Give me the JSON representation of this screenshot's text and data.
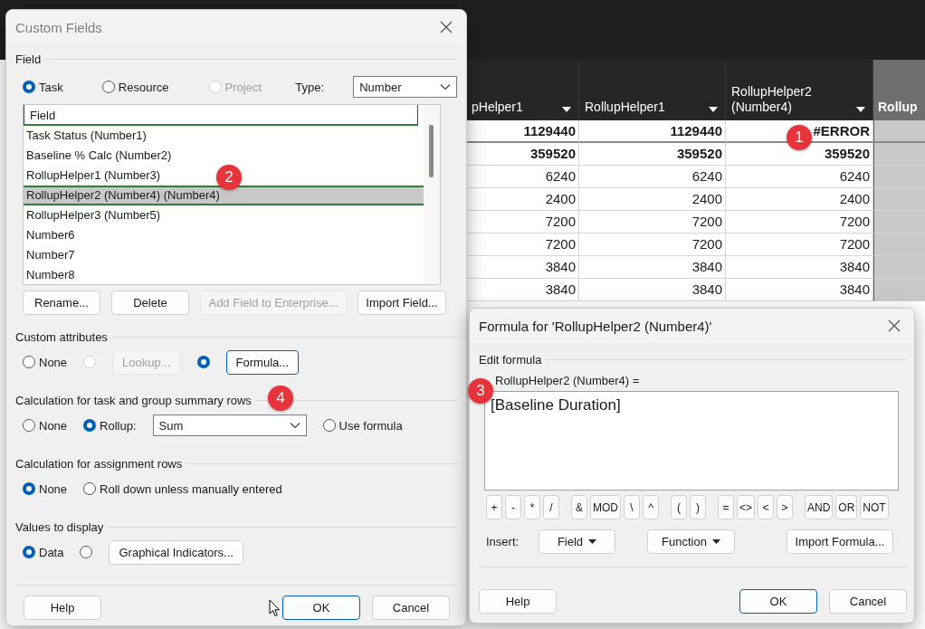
{
  "project_grid": {
    "columns": [
      {
        "header": "pHelper1",
        "selected": false
      },
      {
        "header": "RollupHelper1",
        "selected": false
      },
      {
        "header": "RollupHelper2 (Number4)",
        "selected": false
      },
      {
        "header": "Rollup",
        "selected": true
      }
    ],
    "rows": [
      {
        "bold": true,
        "cells": [
          "1129440",
          "1129440",
          "#ERROR",
          ""
        ]
      },
      {
        "bold": true,
        "cells": [
          "359520",
          "359520",
          "359520",
          ""
        ]
      },
      {
        "bold": false,
        "cells": [
          "6240",
          "6240",
          "6240",
          ""
        ]
      },
      {
        "bold": false,
        "cells": [
          "2400",
          "2400",
          "2400",
          ""
        ]
      },
      {
        "bold": false,
        "cells": [
          "7200",
          "7200",
          "7200",
          ""
        ]
      },
      {
        "bold": false,
        "cells": [
          "7200",
          "7200",
          "7200",
          ""
        ]
      },
      {
        "bold": false,
        "cells": [
          "3840",
          "3840",
          "3840",
          ""
        ]
      },
      {
        "bold": false,
        "cells": [
          "3840",
          "3840",
          "3840",
          ""
        ]
      }
    ]
  },
  "custom_fields_dialog": {
    "title": "Custom Fields",
    "field_section": {
      "label": "Field",
      "entity_options": [
        {
          "label": "Task",
          "selected": true,
          "disabled": false
        },
        {
          "label": "Resource",
          "selected": false,
          "disabled": false
        },
        {
          "label": "Project",
          "selected": false,
          "disabled": true
        }
      ],
      "type_label": "Type:",
      "type_value": "Number"
    },
    "field_list": {
      "header": "Field",
      "items": [
        {
          "label": "Task Status (Number1)",
          "selected": false
        },
        {
          "label": "Baseline % Calc (Number2)",
          "selected": false
        },
        {
          "label": "RollupHelper1 (Number3)",
          "selected": false
        },
        {
          "label": "RollupHelper2 (Number4) (Number4)",
          "selected": true
        },
        {
          "label": "RollupHelper3 (Number5)",
          "selected": false
        },
        {
          "label": "Number6",
          "selected": false
        },
        {
          "label": "Number7",
          "selected": false
        },
        {
          "label": "Number8",
          "selected": false
        }
      ]
    },
    "field_buttons": [
      {
        "label": "Rename...",
        "disabled": false
      },
      {
        "label": "Delete",
        "disabled": false
      },
      {
        "label": "Add Field to Enterprise...",
        "disabled": true
      },
      {
        "label": "Import Field...",
        "disabled": false
      }
    ],
    "sections": [
      {
        "label": "Custom attributes",
        "options": [
          {
            "kind": "radio",
            "label": "None",
            "selected": false,
            "disabled": false
          },
          {
            "kind": "radio",
            "selected": false,
            "disabled": true
          },
          {
            "kind": "button",
            "label": "Lookup...",
            "disabled": true,
            "emphasized": false
          },
          {
            "kind": "radio",
            "selected": true,
            "disabled": false
          },
          {
            "kind": "button",
            "label": "Formula...",
            "disabled": false,
            "emphasized": true
          }
        ]
      },
      {
        "label": "Calculation for task and group summary rows",
        "options": [
          {
            "kind": "radio",
            "label": "None",
            "selected": false,
            "disabled": false
          },
          {
            "kind": "radio",
            "label": "Rollup:",
            "selected": true,
            "disabled": false
          },
          {
            "kind": "dropdown",
            "value": "Sum"
          },
          {
            "kind": "radio",
            "label": "Use formula",
            "selected": false,
            "disabled": false
          }
        ]
      },
      {
        "label": "Calculation for assignment rows",
        "options": [
          {
            "kind": "radio",
            "label": "None",
            "selected": true,
            "disabled": false
          },
          {
            "kind": "radio",
            "label": "Roll down unless manually entered",
            "selected": false,
            "disabled": false
          }
        ]
      },
      {
        "label": "Values to display",
        "options": [
          {
            "kind": "radio",
            "label": "Data",
            "selected": true,
            "disabled": false
          },
          {
            "kind": "radio",
            "selected": false,
            "disabled": false
          },
          {
            "kind": "button",
            "label": "Graphical Indicators...",
            "disabled": false,
            "emphasized": false
          }
        ]
      }
    ],
    "footer_buttons": [
      {
        "label": "Help",
        "emphasized": false
      },
      {
        "label": "OK",
        "emphasized": true
      },
      {
        "label": "Cancel",
        "emphasized": false
      }
    ]
  },
  "formula_dialog": {
    "title": "Formula for 'RollupHelper2 (Number4)'",
    "section_label": "Edit formula",
    "formula_label": "RollupHelper2 (Number4) =",
    "formula": "[Baseline Duration]",
    "operator_groups": [
      [
        "+",
        "-",
        "*",
        "/"
      ],
      [
        "&",
        "MOD",
        "\\",
        "^"
      ],
      [
        "(",
        ")"
      ],
      [
        "=",
        "<>",
        "<",
        ">"
      ],
      [
        "AND",
        "OR",
        "NOT"
      ]
    ],
    "insert_label": "Insert:",
    "insert_buttons": [
      {
        "label": "Field",
        "dropdown": true
      },
      {
        "label": "Function",
        "dropdown": true
      },
      {
        "label": "Import Formula...",
        "dropdown": false
      }
    ],
    "footer_buttons": [
      {
        "label": "Help",
        "emphasized": false
      },
      {
        "label": "OK",
        "emphasized": true
      },
      {
        "label": "Cancel",
        "emphasized": false
      }
    ]
  },
  "annotations": [
    {
      "number": "1"
    },
    {
      "number": "2"
    },
    {
      "number": "3"
    },
    {
      "number": "4"
    }
  ]
}
